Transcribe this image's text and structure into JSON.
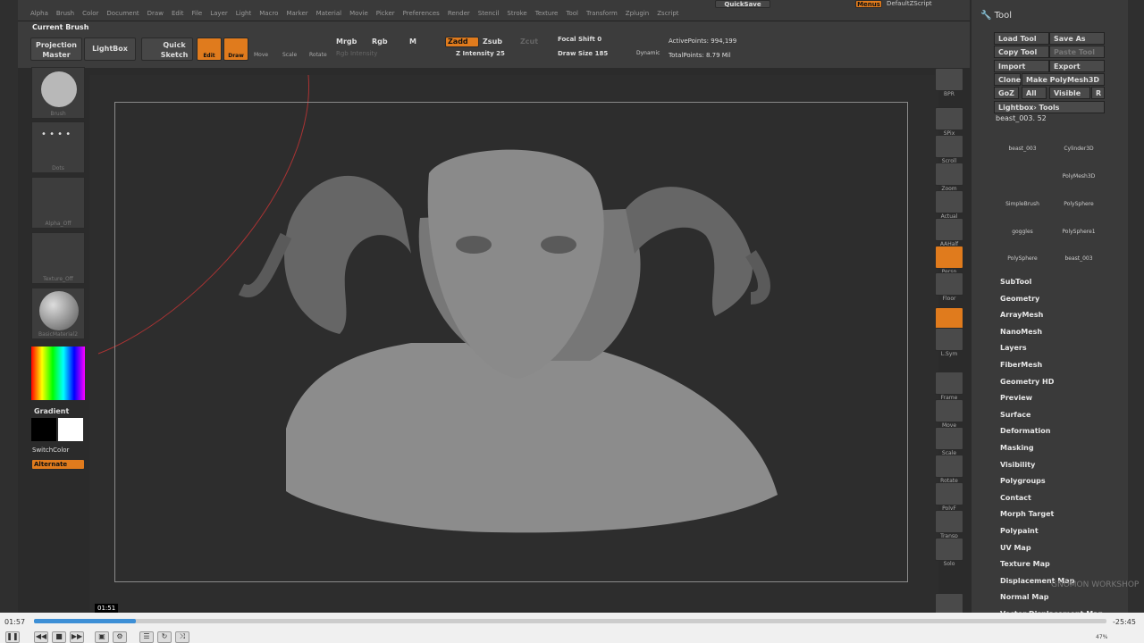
{
  "menu": [
    "Alpha",
    "Brush",
    "Color",
    "Document",
    "Draw",
    "Edit",
    "File",
    "Layer",
    "Light",
    "Macro",
    "Marker",
    "Material",
    "Movie",
    "Picker",
    "Preferences",
    "Render",
    "Stencil",
    "Stroke",
    "Texture",
    "Tool",
    "Transform",
    "Zplugin",
    "Zscript"
  ],
  "top": {
    "quicksave": "QuickSave",
    "menus": "Menus",
    "script": "DefaultZScript"
  },
  "toolbar": {
    "current_brush": "Current Brush",
    "projection_master": "Projection Master",
    "lightbox": "LightBox",
    "quick_sketch": "Quick Sketch",
    "edit": "Edit",
    "draw": "Draw",
    "move": "Move",
    "scale": "Scale",
    "rotate": "Rotate",
    "mrgb": "Mrgb",
    "rgb": "Rgb",
    "m": "M",
    "rgb_intensity": "Rgb Intensity",
    "zadd": "Zadd",
    "zsub": "Zsub",
    "zcut": "Zcut",
    "z_intensity": "Z Intensity 25",
    "focal_shift": "Focal Shift 0",
    "draw_size": "Draw Size 185",
    "dynamic": "Dynamic",
    "active_points": "ActivePoints: 994,199",
    "total_points": "TotalPoints: 8.79 Mil"
  },
  "left": {
    "brush": "Brush",
    "dots": "Dots",
    "alpha": "Alpha_Off",
    "texture": "Texture_Off",
    "material": "BasicMaterial2",
    "gradient": "Gradient",
    "switchcolor": "SwitchColor",
    "alternate": "Alternate"
  },
  "right_tools": [
    "BPR",
    "SPix",
    "Scroll",
    "Zoom",
    "Actual",
    "AAHalf",
    "Persp",
    "Floor",
    "Local",
    "L.Sym",
    "Frame",
    "Move",
    "Scale",
    "Rotate",
    "PolyF",
    "Transp",
    "Solo",
    "Xpose"
  ],
  "panel": {
    "title": "Tool",
    "load": "Load Tool",
    "save": "Save As",
    "copy": "Copy Tool",
    "paste": "Paste Tool",
    "import": "Import",
    "export": "Export",
    "clone": "Clone",
    "make": "Make PolyMesh3D",
    "goz": "GoZ",
    "all": "All",
    "visible": "Visible",
    "r": "R",
    "lightbox_tools": "Lightbox› Tools",
    "current": "beast_003. 52",
    "thumbs": [
      "beast_003",
      "Cylinder3D",
      "PolyMesh3D",
      "SimpleBrush",
      "PolySphere",
      "goggles",
      "PolySphere1",
      "PolySphere",
      "beast_003"
    ],
    "items": [
      "SubTool",
      "Geometry",
      "ArrayMesh",
      "NanoMesh",
      "Layers",
      "FiberMesh",
      "Geometry HD",
      "Preview",
      "Surface",
      "Deformation",
      "Masking",
      "Visibility",
      "Polygroups",
      "Contact",
      "Morph Target",
      "Polypaint",
      "UV Map",
      "Texture Map",
      "Displacement Map",
      "Normal Map",
      "Vector Displacement Map"
    ]
  },
  "player": {
    "elapsed": "01:57",
    "remaining": "-25:45",
    "tooltip": "01:51",
    "progress": 0.095,
    "zoom": "47%"
  },
  "watermark": "GNOMON WORKSHOP"
}
